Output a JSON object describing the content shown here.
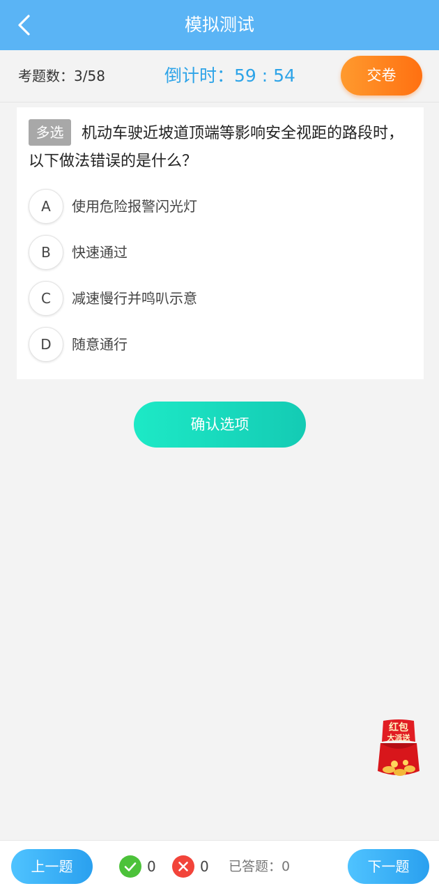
{
  "header": {
    "title": "模拟测试",
    "back_icon": "back-arrow-icon"
  },
  "info": {
    "count_label": "考题数：",
    "count_value": "3/58",
    "timer_label": "倒计时：",
    "timer_value": "59 : 54",
    "submit_label": "交卷"
  },
  "question": {
    "type_badge": "多选",
    "text": "机动车驶近坡道顶端等影响安全视距的路段时，以下做法错误的是什么？",
    "options": [
      {
        "letter": "A",
        "text": "使用危险报警闪光灯"
      },
      {
        "letter": "B",
        "text": "快速通过"
      },
      {
        "letter": "C",
        "text": "减速慢行并鸣叭示意"
      },
      {
        "letter": "D",
        "text": "随意通行"
      }
    ]
  },
  "confirm_label": "确认选项",
  "promo": {
    "line1": "红包",
    "line2": "大派送"
  },
  "bottom": {
    "prev_label": "上一题",
    "next_label": "下一题",
    "correct_count": "0",
    "wrong_count": "0",
    "answered_label": "已答题：",
    "answered_value": "0"
  },
  "colors": {
    "header": "#5ab4f5",
    "timer": "#2ea4e8",
    "submit": "#ff7e1c",
    "confirm": "#18d9bd",
    "nav_button": "#3ab0f5",
    "correct": "#4cc23a",
    "wrong": "#f2443a"
  }
}
